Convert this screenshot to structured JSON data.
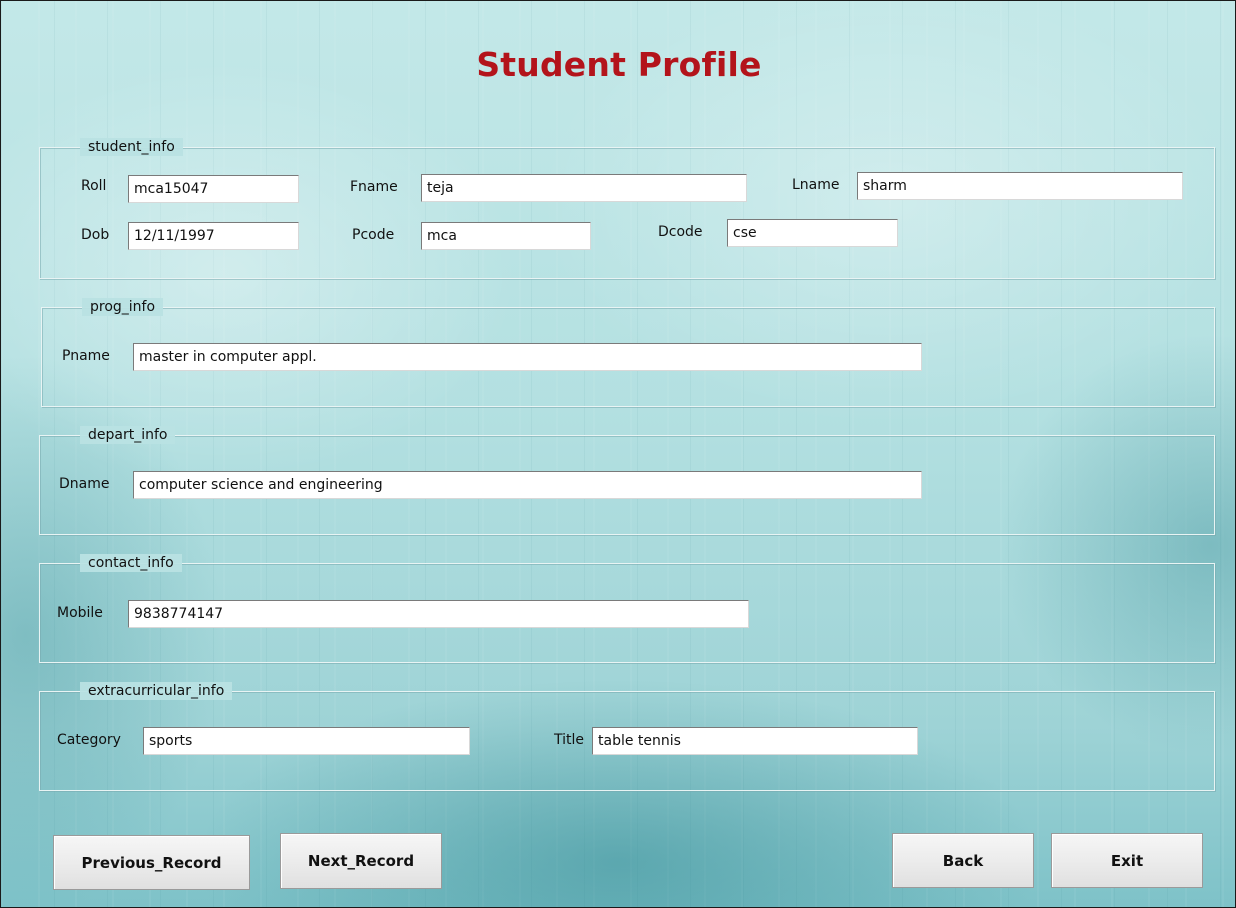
{
  "window": {
    "title": "Student Profile"
  },
  "student_info": {
    "legend": "student_info",
    "roll_label": "Roll",
    "roll_value": "mca15047",
    "fname_label": "Fname",
    "fname_value": "teja",
    "lname_label": "Lname",
    "lname_value": "sharm",
    "dob_label": "Dob",
    "dob_value": "12/11/1997",
    "pcode_label": "Pcode",
    "pcode_value": "mca",
    "dcode_label": "Dcode",
    "dcode_value": "cse"
  },
  "prog_info": {
    "legend": "prog_info",
    "pname_label": "Pname",
    "pname_value": "master in computer appl."
  },
  "depart_info": {
    "legend": "depart_info",
    "dname_label": "Dname",
    "dname_value": "computer science and engineering"
  },
  "contact_info": {
    "legend": "contact_info",
    "mobile_label": "Mobile",
    "mobile_value": "9838774147"
  },
  "extracurricular_info": {
    "legend": "extracurricular_info",
    "category_label": "Category",
    "category_value": "sports",
    "title_label": "Title",
    "title_value": "table tennis"
  },
  "buttons": {
    "previous": "Previous_Record",
    "next": "Next_Record",
    "back": "Back",
    "exit": "Exit"
  },
  "colors": {
    "title": "#b3141b",
    "background": "#b3e0e1"
  }
}
